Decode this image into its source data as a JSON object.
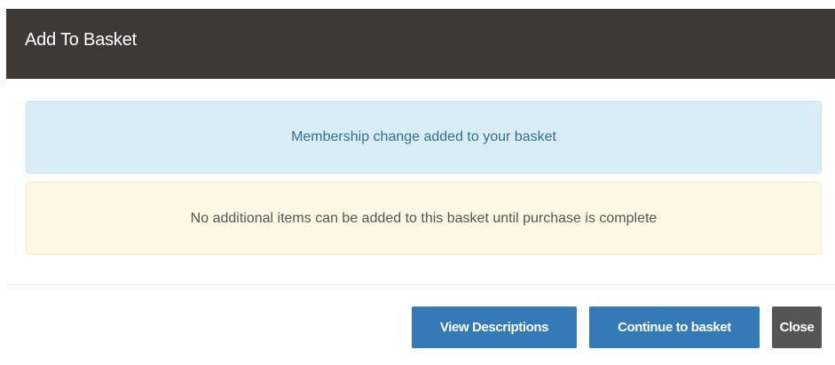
{
  "modal": {
    "title": "Add To Basket"
  },
  "alerts": {
    "info_message": "Membership change added to your basket",
    "warning_message": "No additional items can be added to this basket until purchase is complete"
  },
  "footer": {
    "view_descriptions_label": "View Descriptions",
    "continue_label": "Continue to basket",
    "close_label": "Close"
  },
  "colors": {
    "header_bg": "#3d3a36",
    "primary_button": "#337ab7",
    "close_button": "#555555",
    "info_bg": "#d9edf7",
    "warning_bg": "#fcf8e3"
  }
}
